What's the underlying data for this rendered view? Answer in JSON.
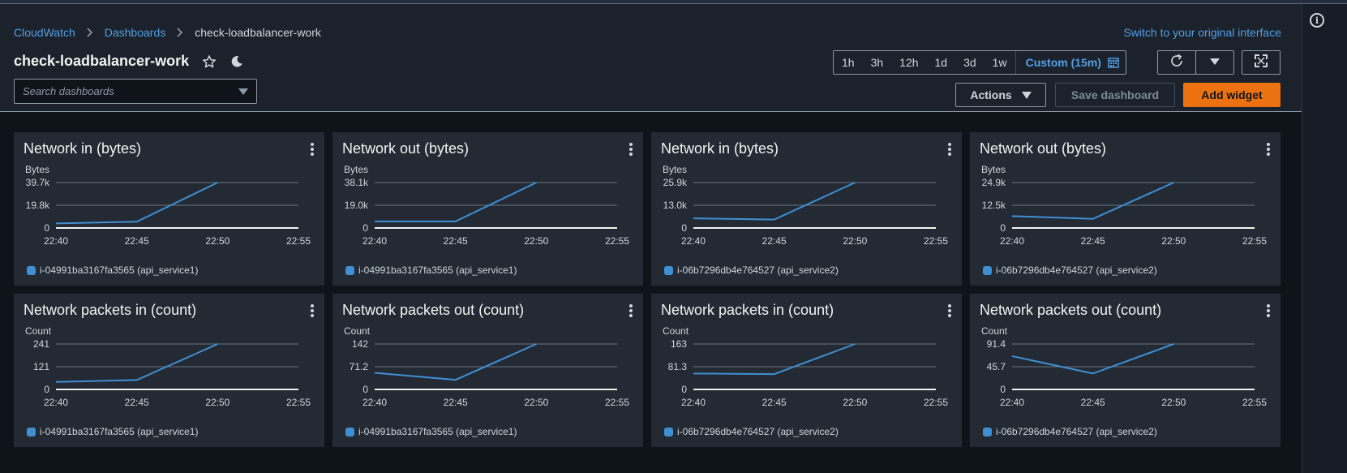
{
  "colors": {
    "accent_link": "#539fe5",
    "primary_button": "#ec7211",
    "series_line": "#3f8fd4"
  },
  "breadcrumb": {
    "items": [
      "CloudWatch",
      "Dashboards"
    ],
    "current": "check-loadbalancer-work"
  },
  "switch_link": "Switch to your original interface",
  "title": "check-loadbalancer-work",
  "search": {
    "placeholder": "Search dashboards"
  },
  "time_range": {
    "options": [
      "1h",
      "3h",
      "12h",
      "1d",
      "3d",
      "1w"
    ],
    "custom": "Custom (15m)"
  },
  "actions_label": "Actions",
  "save_label": "Save dashboard",
  "add_widget_label": "Add widget",
  "icons": [
    "chevron-right-icon",
    "star-icon",
    "moon-icon",
    "calendar-icon",
    "refresh-icon",
    "caret-down-icon",
    "fullscreen-icon",
    "info-icon",
    "kebab-menu-icon"
  ],
  "widgets": [
    {
      "title": "Network in (bytes)",
      "chart_data": {
        "type": "line",
        "ylabel": "Bytes",
        "yticks": [
          "0",
          "19.8k",
          "39.7k"
        ],
        "ylim": [
          0,
          39700
        ],
        "x": [
          "22:40",
          "22:45",
          "22:50",
          "22:55"
        ],
        "series": [
          {
            "name": "i-04991ba3167fa3565 (api_service1)",
            "values": [
              4000,
              5500,
              39700
            ]
          }
        ]
      }
    },
    {
      "title": "Network out (bytes)",
      "chart_data": {
        "type": "line",
        "ylabel": "Bytes",
        "yticks": [
          "0",
          "19.0k",
          "38.1k"
        ],
        "ylim": [
          0,
          38100
        ],
        "x": [
          "22:40",
          "22:45",
          "22:50",
          "22:55"
        ],
        "series": [
          {
            "name": "i-04991ba3167fa3565 (api_service1)",
            "values": [
              5500,
              5500,
              38100
            ]
          }
        ]
      }
    },
    {
      "title": "Network in (bytes)",
      "chart_data": {
        "type": "line",
        "ylabel": "Bytes",
        "yticks": [
          "0",
          "13.0k",
          "25.9k"
        ],
        "ylim": [
          0,
          25900
        ],
        "x": [
          "22:40",
          "22:45",
          "22:50",
          "22:55"
        ],
        "series": [
          {
            "name": "i-06b7296db4e764527 (api_service2)",
            "values": [
              5500,
              4800,
              25900
            ]
          }
        ]
      }
    },
    {
      "title": "Network out (bytes)",
      "chart_data": {
        "type": "line",
        "ylabel": "Bytes",
        "yticks": [
          "0",
          "12.5k",
          "24.9k"
        ],
        "ylim": [
          0,
          24900
        ],
        "x": [
          "22:40",
          "22:45",
          "22:50",
          "22:55"
        ],
        "series": [
          {
            "name": "i-06b7296db4e764527 (api_service2)",
            "values": [
              6500,
              5000,
              24900
            ]
          }
        ]
      }
    },
    {
      "title": "Network packets in (count)",
      "chart_data": {
        "type": "line",
        "ylabel": "Count",
        "yticks": [
          "0",
          "121",
          "241"
        ],
        "ylim": [
          0,
          241
        ],
        "x": [
          "22:40",
          "22:45",
          "22:50",
          "22:55"
        ],
        "series": [
          {
            "name": "i-04991ba3167fa3565 (api_service1)",
            "values": [
              40,
              50,
              241
            ]
          }
        ]
      }
    },
    {
      "title": "Network packets out (count)",
      "chart_data": {
        "type": "line",
        "ylabel": "Count",
        "yticks": [
          "0",
          "71.2",
          "142"
        ],
        "ylim": [
          0,
          142
        ],
        "x": [
          "22:40",
          "22:45",
          "22:50",
          "22:55"
        ],
        "series": [
          {
            "name": "i-04991ba3167fa3565 (api_service1)",
            "values": [
              52,
              30,
              142
            ]
          }
        ]
      }
    },
    {
      "title": "Network packets in (count)",
      "chart_data": {
        "type": "line",
        "ylabel": "Count",
        "yticks": [
          "0",
          "81.3",
          "163"
        ],
        "ylim": [
          0,
          163
        ],
        "x": [
          "22:40",
          "22:45",
          "22:50",
          "22:55"
        ],
        "series": [
          {
            "name": "i-06b7296db4e764527 (api_service2)",
            "values": [
              57,
              55,
              163
            ]
          }
        ]
      }
    },
    {
      "title": "Network packets out (count)",
      "chart_data": {
        "type": "line",
        "ylabel": "Count",
        "yticks": [
          "0",
          "45.7",
          "91.4"
        ],
        "ylim": [
          0,
          91.4
        ],
        "x": [
          "22:40",
          "22:45",
          "22:50",
          "22:55"
        ],
        "series": [
          {
            "name": "i-06b7296db4e764527 (api_service2)",
            "values": [
              67,
              32,
              91.4
            ]
          }
        ]
      }
    }
  ]
}
